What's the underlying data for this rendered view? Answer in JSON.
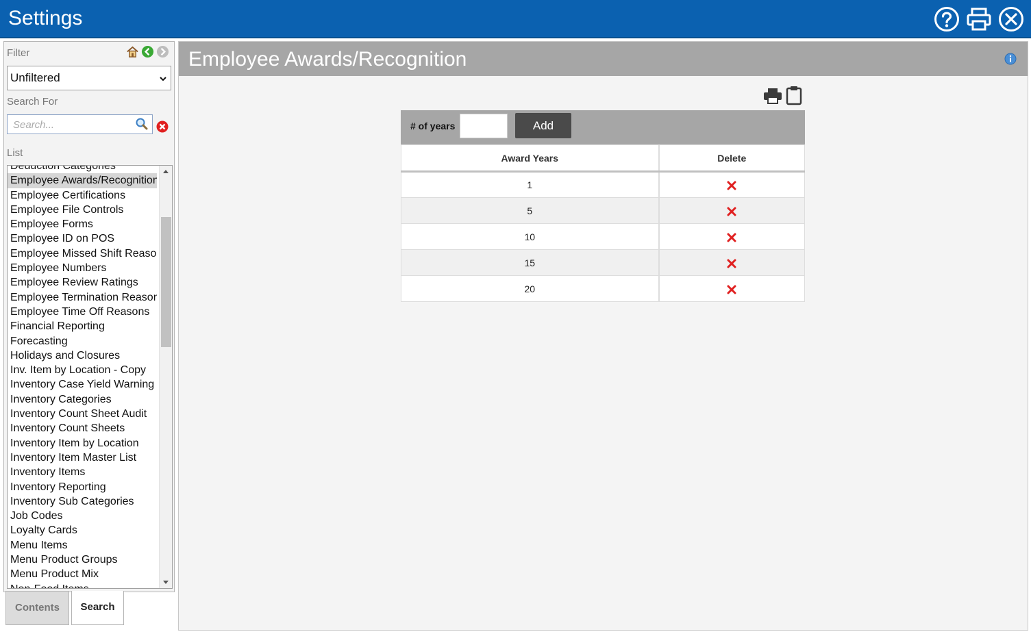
{
  "app": {
    "title": "Settings"
  },
  "topbar": {
    "icons": [
      "help-icon",
      "print-icon",
      "close-icon"
    ]
  },
  "left": {
    "filter_label": "Filter",
    "filter_value": "Unfiltered",
    "search_label": "Search For",
    "search_placeholder": "Search...",
    "list_label": "List",
    "items": [
      "Deduction Categories",
      "Employee Awards/Recognition",
      "Employee Certifications",
      "Employee File Controls",
      "Employee Forms",
      "Employee ID on POS",
      "Employee Missed Shift Reasons",
      "Employee Numbers",
      "Employee Review Ratings",
      "Employee Termination Reasons",
      "Employee Time Off Reasons",
      "Financial Reporting",
      "Forecasting",
      "Holidays and Closures",
      "Inv. Item by Location - Copy",
      "Inventory Case Yield Warning",
      "Inventory Categories",
      "Inventory Count Sheet Audit",
      "Inventory Count Sheets",
      "Inventory Item by Location",
      "Inventory Item Master List",
      "Inventory Items",
      "Inventory Reporting",
      "Inventory Sub Categories",
      "Job Codes",
      "Loyalty Cards",
      "Menu Items",
      "Menu Product Groups",
      "Menu Product Mix",
      "Non-Food Items"
    ],
    "selected_index": 1,
    "tabs": {
      "contents": "Contents",
      "search": "Search"
    }
  },
  "main": {
    "title": "Employee Awards/Recognition",
    "years_label": "# of years",
    "years_value": "",
    "add_label": "Add",
    "table": {
      "headers": [
        "Award Years",
        "Delete"
      ],
      "rows": [
        "1",
        "5",
        "10",
        "15",
        "20"
      ]
    }
  },
  "colors": {
    "topbar": "#0b61b0",
    "header_gray": "#a6a6a6",
    "delete_red": "#e02020",
    "add_button": "#4a4a4a"
  }
}
